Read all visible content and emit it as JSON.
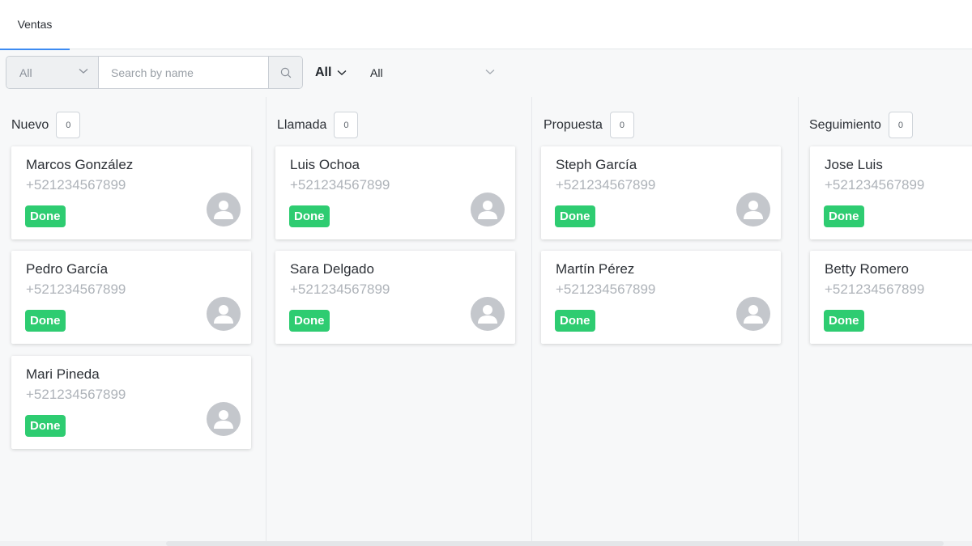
{
  "tabs": [
    {
      "label": "Ventas",
      "active": true
    }
  ],
  "filters": {
    "scope_value": "All",
    "search_placeholder": "Search by name",
    "search_value": "",
    "status_value": "All",
    "owner_value": "All"
  },
  "colors": {
    "accent": "#3d8bf2",
    "badge_done": "#2ecc71",
    "avatar": "#c4c7cc"
  },
  "columns": [
    {
      "title": "Nuevo",
      "count": "0",
      "cards": [
        {
          "name": "Marcos González",
          "phone": "+521234567899",
          "status": "Done",
          "avatar_icon": "user-placeholder-icon"
        },
        {
          "name": "Pedro García",
          "phone": "+521234567899",
          "status": "Done",
          "avatar_icon": "user-placeholder-icon"
        },
        {
          "name": "Mari Pineda",
          "phone": "+521234567899",
          "status": "Done",
          "avatar_icon": "user-placeholder-icon"
        }
      ]
    },
    {
      "title": "Llamada",
      "count": "0",
      "cards": [
        {
          "name": "Luis Ochoa",
          "phone": "+521234567899",
          "status": "Done",
          "avatar_icon": "user-placeholder-icon"
        },
        {
          "name": "Sara Delgado",
          "phone": "+521234567899",
          "status": "Done",
          "avatar_icon": "user-placeholder-icon"
        }
      ]
    },
    {
      "title": "Propuesta",
      "count": "0",
      "cards": [
        {
          "name": "Steph García",
          "phone": "+521234567899",
          "status": "Done",
          "avatar_icon": "user-placeholder-icon"
        },
        {
          "name": "Martín Pérez",
          "phone": "+521234567899",
          "status": "Done",
          "avatar_icon": "user-placeholder-icon"
        }
      ]
    },
    {
      "title": "Seguimiento",
      "count": "0",
      "cards": [
        {
          "name": "Jose Luis",
          "phone": "+521234567899",
          "status": "Done",
          "avatar_icon": "user-placeholder-icon"
        },
        {
          "name": "Betty Romero",
          "phone": "+521234567899",
          "status": "Done",
          "avatar_icon": "user-placeholder-icon"
        }
      ]
    }
  ]
}
